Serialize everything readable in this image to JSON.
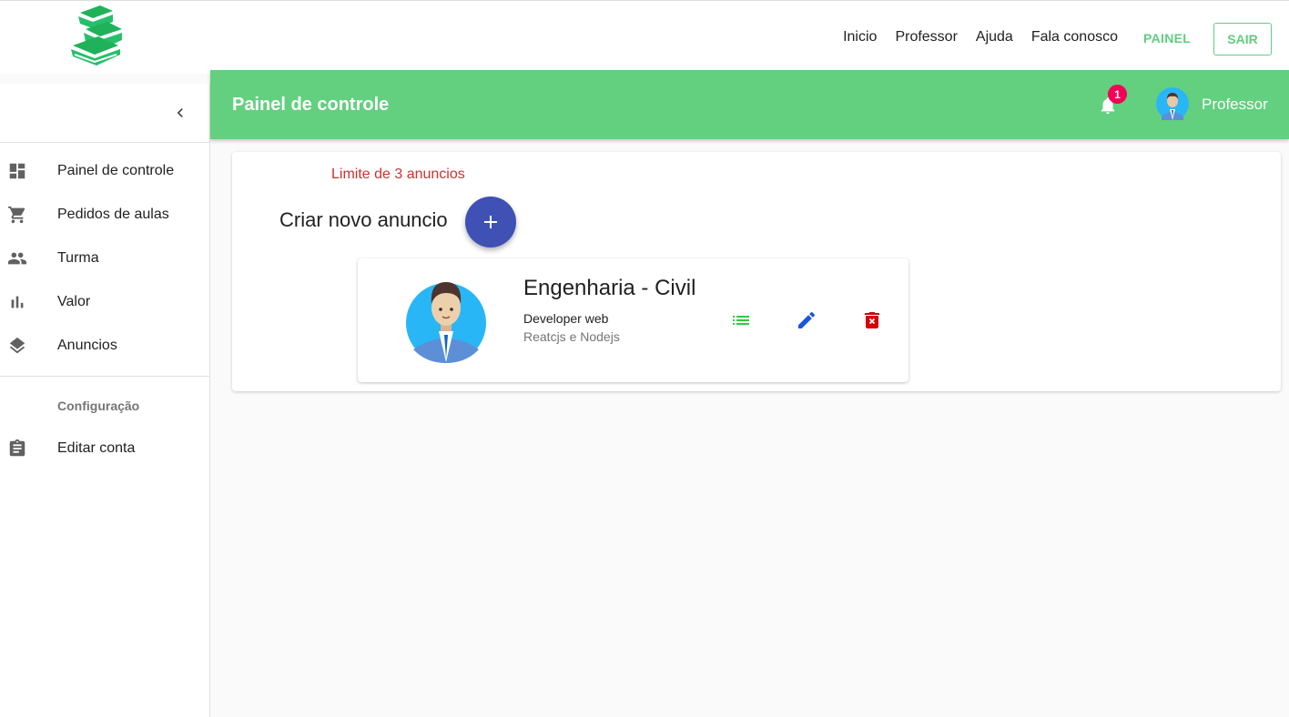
{
  "topnav": {
    "links": [
      "Inicio",
      "Professor",
      "Ajuda",
      "Fala conosco"
    ],
    "painel_label": "PAINEL",
    "sair_label": "SAIR"
  },
  "sidebar": {
    "items": [
      {
        "label": "Painel de controle",
        "icon": "dashboard-icon"
      },
      {
        "label": "Pedidos de aulas",
        "icon": "cart-icon"
      },
      {
        "label": "Turma",
        "icon": "people-icon"
      },
      {
        "label": "Valor",
        "icon": "bar-chart-icon"
      },
      {
        "label": "Anuncios",
        "icon": "layers-icon"
      }
    ],
    "section_label": "Configuração",
    "settings_items": [
      {
        "label": "Editar conta",
        "icon": "assignment-icon"
      }
    ]
  },
  "appbar": {
    "title": "Painel de controle",
    "notification_count": "1",
    "user_name": "Professor"
  },
  "main": {
    "limit_text": "Limite de 3 anuncios",
    "create_label": "Criar novo anuncio",
    "ad": {
      "title": "Engenharia - Civil",
      "subtitle": "Developer web",
      "description": "Reatcjs e Nodejs"
    }
  },
  "colors": {
    "brand_green": "#62d07f",
    "fab_blue": "#3f51b5",
    "limit_red": "#d32f2f",
    "list_icon_green": "#2ecc40",
    "edit_icon_blue": "#1a56db",
    "delete_icon_red": "#d50000"
  }
}
